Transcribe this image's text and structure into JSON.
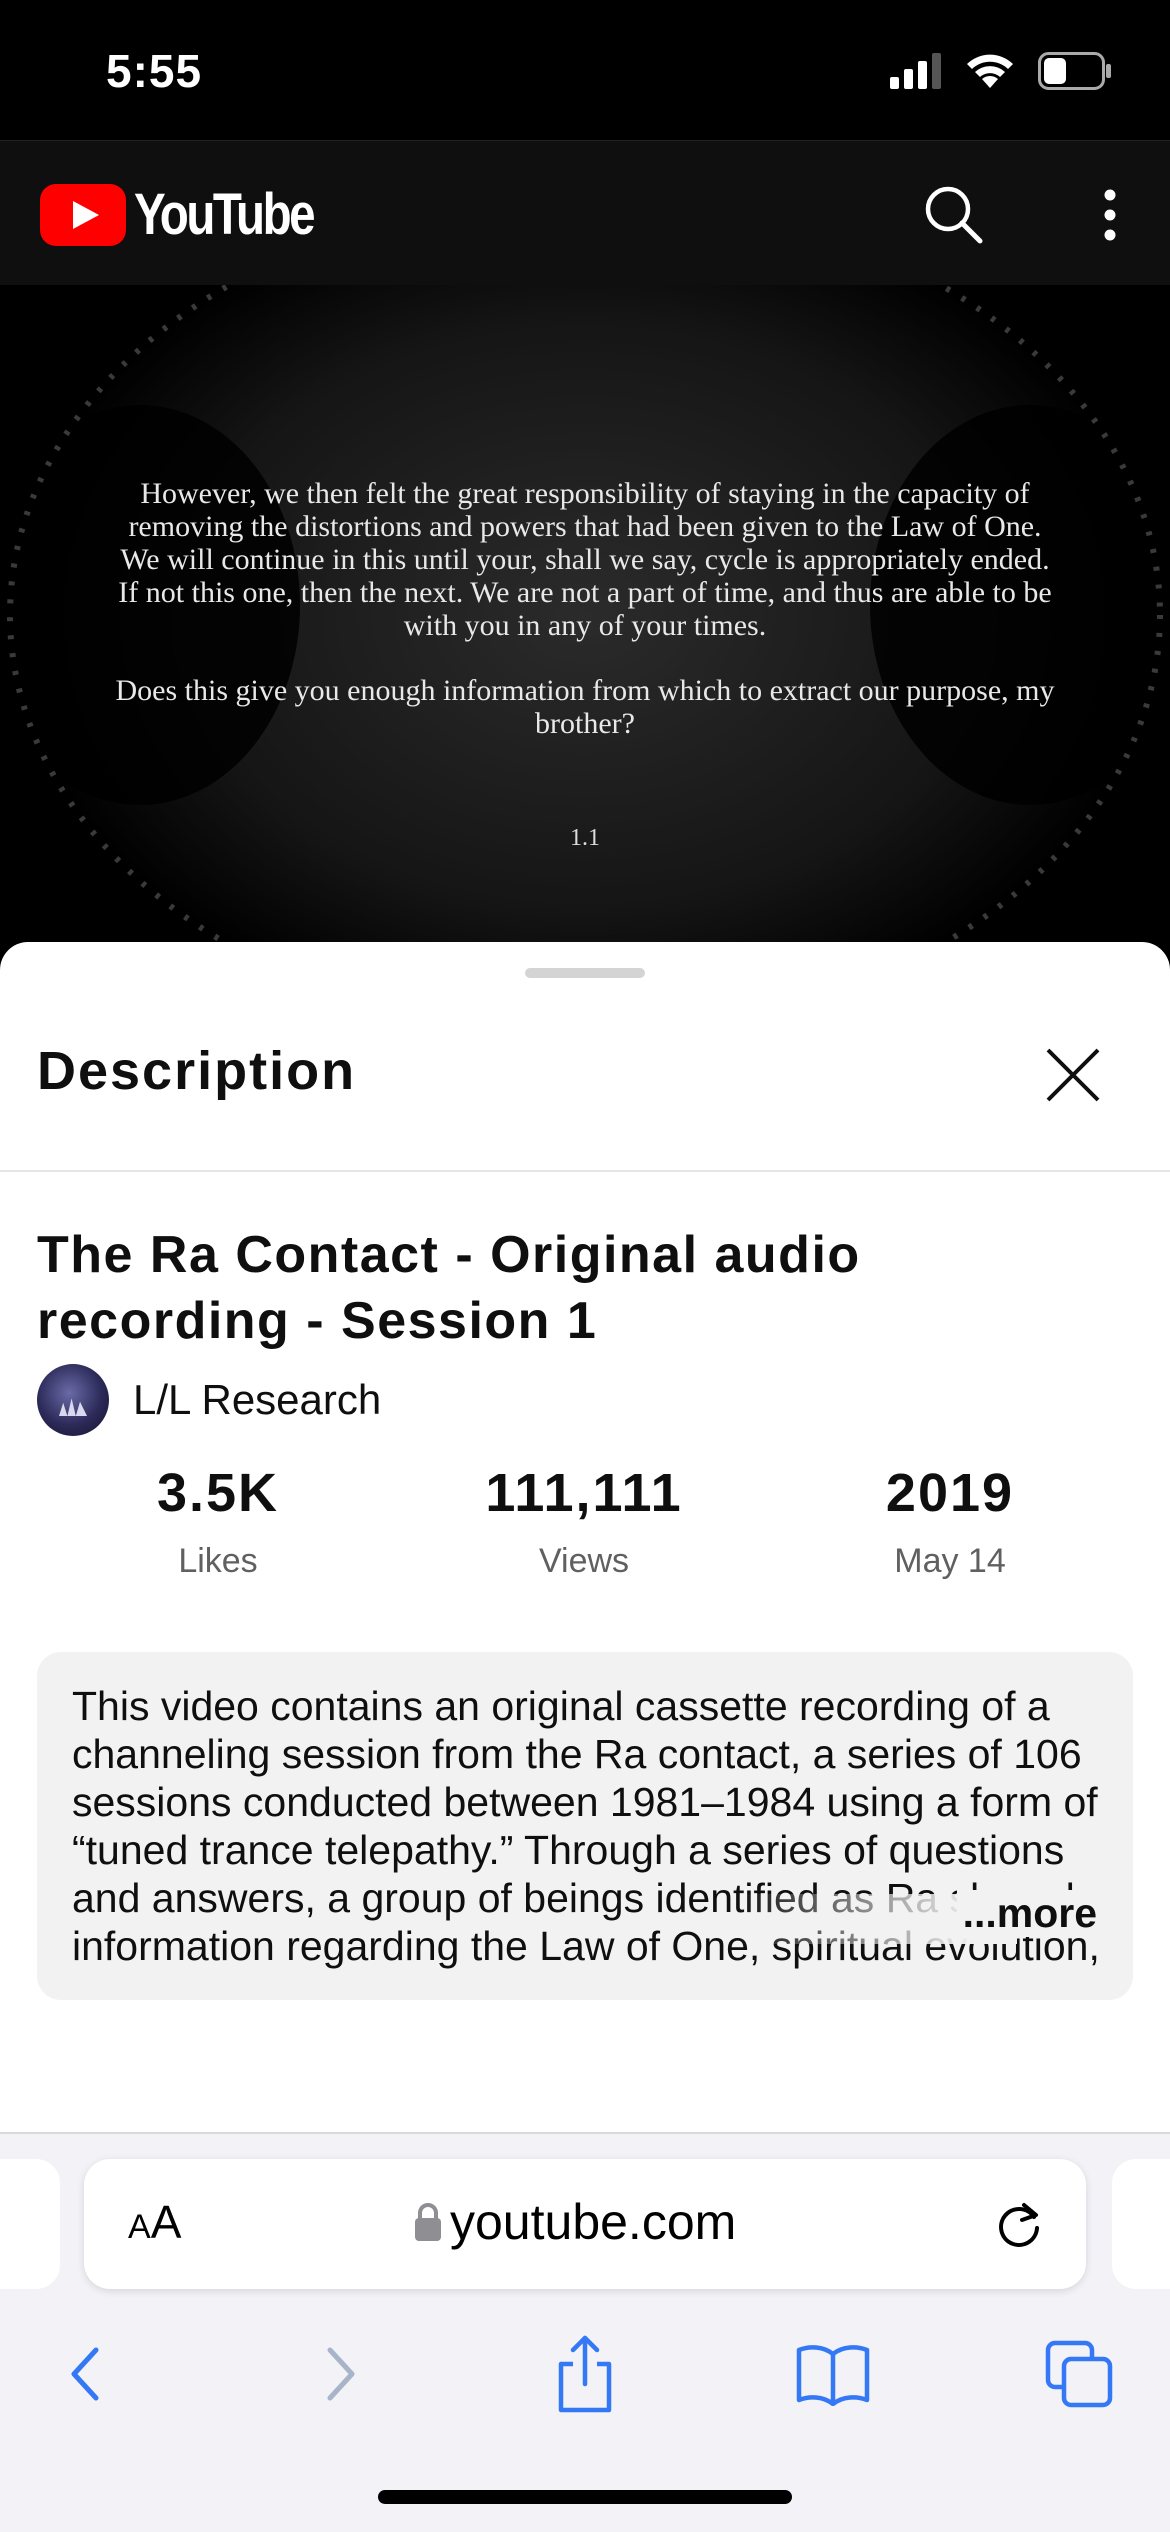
{
  "status_bar": {
    "time": "5:55"
  },
  "header": {
    "logo_text": "YouTube"
  },
  "video": {
    "paragraphs": [
      "However, we then felt the great responsibility of staying in the capacity of removing the distortions and powers that had been given to the Law of One. We will continue in this until your, shall we say, cycle is appropriately ended. If not this one, then the next. We are not a part of time, and thus are able to be with you in any of your times.",
      "Does this give you enough information from which to extract our purpose, my brother?"
    ],
    "page_label": "1.1"
  },
  "sheet": {
    "title": "Description",
    "video_title": "The Ra Contact - Original audio recording - Session 1",
    "channel_name": "L/L Research",
    "stats": {
      "likes_value": "3.5K",
      "likes_label": "Likes",
      "views_value": "111,111",
      "views_label": "Views",
      "date_value": "2019",
      "date_label": "May 14"
    },
    "description": "This video contains an original cassette recording of a channeling session from the Ra contact, a series of 106 sessions conducted between 1981–1984 using a form of “tuned trance telepathy.” Through a series of questions and answers, a group of beings identified as Ra shared information regarding the Law of One, spiritual evolution, and a variety of esoteric topics.",
    "more_label": "...more"
  },
  "safari": {
    "aa_small": "A",
    "aa_large": "A",
    "url": "youtube.com"
  },
  "colors": {
    "yt_red": "#ff0000",
    "ios_blue": "#3478f6"
  }
}
